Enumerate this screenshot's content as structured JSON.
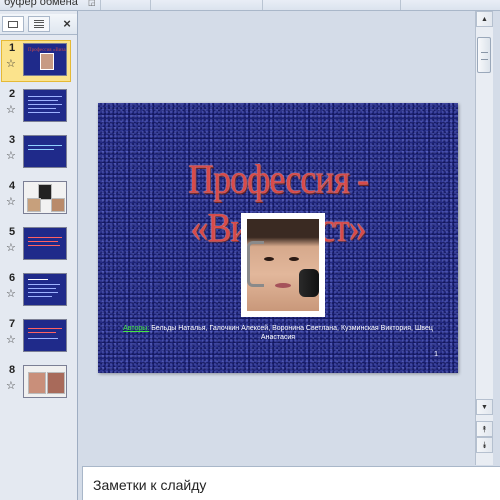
{
  "ribbon": {
    "group_label": "буфер обмена"
  },
  "panel": {
    "tabs": [
      {
        "name": "slides"
      },
      {
        "name": "outline"
      }
    ],
    "close_label": "×"
  },
  "thumbnails": [
    {
      "number": "1",
      "selected": true
    },
    {
      "number": "2",
      "selected": false
    },
    {
      "number": "3",
      "selected": false
    },
    {
      "number": "4",
      "selected": false
    },
    {
      "number": "5",
      "selected": false
    },
    {
      "number": "6",
      "selected": false
    },
    {
      "number": "7",
      "selected": false
    },
    {
      "number": "8",
      "selected": false
    }
  ],
  "slide": {
    "title": "Профессия - «Визажист»",
    "authors_label": "Авторы:",
    "authors_text": " Бельды Наталья, Галочкин Алексей, Воронина Светлана, Кузминская Виктория, Швец Анастасия",
    "number": "1"
  },
  "notes": {
    "placeholder": "Заметки к слайду"
  },
  "colors": {
    "slide_bg": "#1b2278",
    "title": "#d84a4a",
    "authors_label": "#44e644",
    "selection": "#fbe38c"
  }
}
